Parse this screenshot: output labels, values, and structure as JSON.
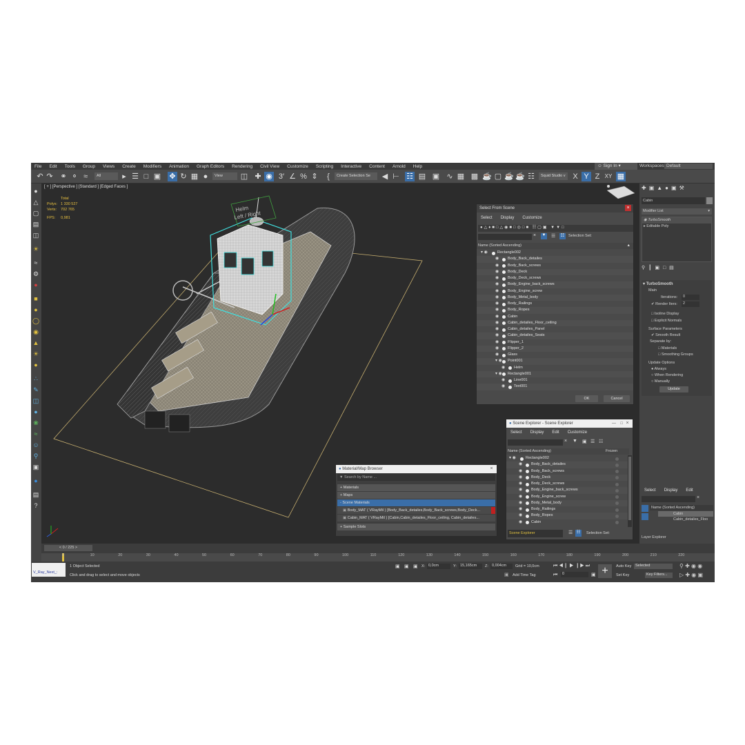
{
  "menu": [
    "File",
    "Edit",
    "Tools",
    "Group",
    "Views",
    "Create",
    "Modifiers",
    "Animation",
    "Graph Editors",
    "Rendering",
    "Civil View",
    "Customize",
    "Scripting",
    "Interactive",
    "Content",
    "Arnold",
    "Help"
  ],
  "signin": "Sign In",
  "workspaces": {
    "label": "Workspaces:",
    "value": "Default"
  },
  "toolbar": {
    "filter": "All",
    "view": "View",
    "selection_set": "Create Selection Se",
    "studio": "Squid Studio v",
    "axes": [
      "X",
      "Y",
      "Z",
      "XY"
    ]
  },
  "viewport": {
    "label": "[ + ] [Perspective ] [Standard ] [Edged Faces ]",
    "stats": {
      "total": "Total",
      "polys_label": "Polys:",
      "polys": "1 330 527",
      "verts_label": "Verts:",
      "verts": "702 765",
      "fps_label": "FPS:",
      "fps": "0,981"
    },
    "helm_text": "Helm",
    "left_right_text": "Left / Right"
  },
  "select_from_scene": {
    "title": "Select From Scene",
    "tabs": [
      "Select",
      "Display",
      "Customize"
    ],
    "selection_set": "Selection Set:",
    "column": "Name (Sorted Ascending)",
    "items": [
      {
        "name": "Rectangle002",
        "level": 0
      },
      {
        "name": "Body_Back_detailes",
        "level": 1
      },
      {
        "name": "Body_Back_screws",
        "level": 1
      },
      {
        "name": "Body_Deck",
        "level": 1
      },
      {
        "name": "Body_Deck_screws",
        "level": 1
      },
      {
        "name": "Body_Engine_back_screws",
        "level": 1
      },
      {
        "name": "Body_Engine_screw",
        "level": 1
      },
      {
        "name": "Body_Metal_body",
        "level": 1
      },
      {
        "name": "Body_Railings",
        "level": 1
      },
      {
        "name": "Body_Ropes",
        "level": 1
      },
      {
        "name": "Cabin",
        "level": 1
      },
      {
        "name": "Cabin_detailes_Floor_ceiling",
        "level": 1
      },
      {
        "name": "Cabin_detailes_Panel",
        "level": 1
      },
      {
        "name": "Cabin_detailes_Seats",
        "level": 1
      },
      {
        "name": "Flipper_1",
        "level": 1
      },
      {
        "name": "Flipper_2",
        "level": 1
      },
      {
        "name": "Glass",
        "level": 1
      },
      {
        "name": "Point001",
        "level": 1
      },
      {
        "name": "Helm",
        "level": 2
      },
      {
        "name": "Rectangle001",
        "level": 1
      },
      {
        "name": "Line001",
        "level": 2
      },
      {
        "name": "Text001",
        "level": 2
      }
    ],
    "ok": "OK",
    "cancel": "Cancel"
  },
  "scene_explorer": {
    "title": "Scene Explorer - Scene Explorer",
    "tabs": [
      "Select",
      "Display",
      "Edit",
      "Customize"
    ],
    "column": "Name (Sorted Ascending)",
    "frozen": "Frozen",
    "items": [
      "Rectangle002",
      "Body_Back_detailes",
      "Body_Back_screws",
      "Body_Deck",
      "Body_Deck_screws",
      "Body_Engine_back_screws",
      "Body_Engine_screw",
      "Body_Metal_body",
      "Body_Railings",
      "Body_Ropes",
      "Cabin"
    ],
    "footer": "Scene Explorer",
    "selection_set": "Selection Set:"
  },
  "material_browser": {
    "title": "Material/Map Browser",
    "search": "Search by Name ...",
    "sections": [
      "+ Materials",
      "+ Maps",
      "- Scene Materials"
    ],
    "materials": [
      "Body_MAT ( VRayMtl ) [Body_Back_detailes,Body_Back_screws,Body_Deck...",
      "Cabin_MAT ( VRayMtl ) [Cabin,Cabin_detailes_Floor_ceiling, Cabin_detailes..."
    ],
    "sample_slots": "+ Sample Slots"
  },
  "command_panel": {
    "object_name": "Cabin",
    "modifier_list": "Modifier List",
    "stack": [
      "TurboSmooth",
      "Editable Poly"
    ],
    "rollout": "TurboSmooth",
    "main": "Main",
    "iterations_label": "Iterations:",
    "iterations": "0",
    "render_iters_label": "Render Iters:",
    "render_iters": "2",
    "isoline": "Isoline Display",
    "explicit": "Explicit Normals",
    "surface_params": "Surface Parameters",
    "smooth_result": "Smooth Result",
    "separate_by": "Separate by:",
    "materials": "Materials",
    "smoothing_groups": "Smoothing Groups",
    "update_options": "Update Options",
    "always": "Always",
    "when_rendering": "When Rendering",
    "manually": "Manually",
    "update": "Update"
  },
  "layer_panel": {
    "tabs": [
      "Select",
      "Display",
      "Edit"
    ],
    "column": "Name (Sorted Ascending)",
    "items": [
      "Cabin",
      "Cabin_detailes_Floo"
    ],
    "footer": "Layer Explorer"
  },
  "timeline": {
    "frame": "0 / 225",
    "ticks": [
      "0",
      "10",
      "20",
      "30",
      "40",
      "50",
      "60",
      "70",
      "80",
      "90",
      "100",
      "110",
      "120",
      "130",
      "140",
      "150",
      "160",
      "170",
      "180",
      "190",
      "200",
      "210",
      "220"
    ]
  },
  "status": {
    "script": "V_Ray_Next_:",
    "selected": "1 Object Selected",
    "hint": "Click and drag to select and move objects",
    "x_label": "X:",
    "x": "0,0cm",
    "y_label": "Y:",
    "y": "15,165cm",
    "z_label": "Z:",
    "z": "0,004cm",
    "grid": "Grid = 10,0cm",
    "add_time_tag": "Add Time Tag",
    "auto_key": "Auto Key",
    "selected_drop": "Selected",
    "set_key": "Set Key",
    "key_filters": "Key Filters...",
    "frame_field": "0"
  }
}
